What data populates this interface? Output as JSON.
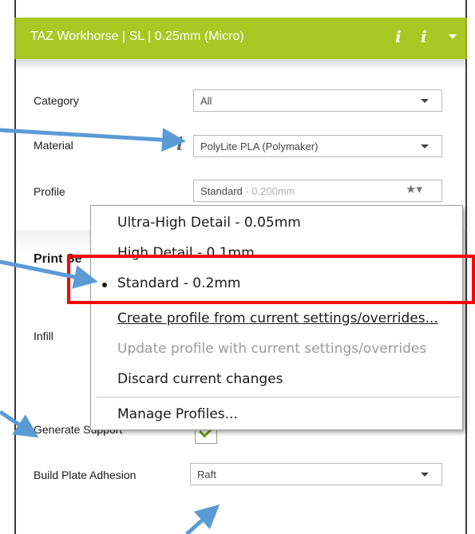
{
  "header": {
    "title": "TAZ Workhorse | SL | 0.25mm (Micro)",
    "icon1": "i",
    "icon2": "i",
    "background": "#aac823"
  },
  "settings": {
    "category": {
      "label": "Category",
      "value": "All"
    },
    "material": {
      "label": "Material",
      "value": "PolyLite PLA (Polymaker)",
      "info_icon": "i"
    },
    "profile": {
      "label": "Profile",
      "value": "Standard",
      "value_suffix": " - 0.200mm"
    },
    "section_title": "Print Se",
    "infill_label": "Infill",
    "generate_support_label": "Generate Support",
    "build_plate": {
      "label": "Build Plate Adhesion",
      "value": "Raft"
    }
  },
  "profile_menu": {
    "items": [
      {
        "label": "Ultra-High Detail - 0.05mm",
        "enabled": true,
        "checked": false
      },
      {
        "label": "High Detail - 0.1mm",
        "enabled": true,
        "checked": false
      },
      {
        "label": "Standard - 0.2mm",
        "enabled": true,
        "checked": true
      }
    ],
    "actions": [
      {
        "label": "Create profile from current settings/overrides...",
        "enabled": true
      },
      {
        "label": "Update profile with current settings/overrides",
        "enabled": false
      },
      {
        "label": "Discard current changes",
        "enabled": true
      }
    ],
    "manage": {
      "label": "Manage Profiles...",
      "enabled": true
    }
  },
  "annotations": {
    "arrow_color": "#5b9bd5",
    "highlight_color": "#ff0000"
  }
}
